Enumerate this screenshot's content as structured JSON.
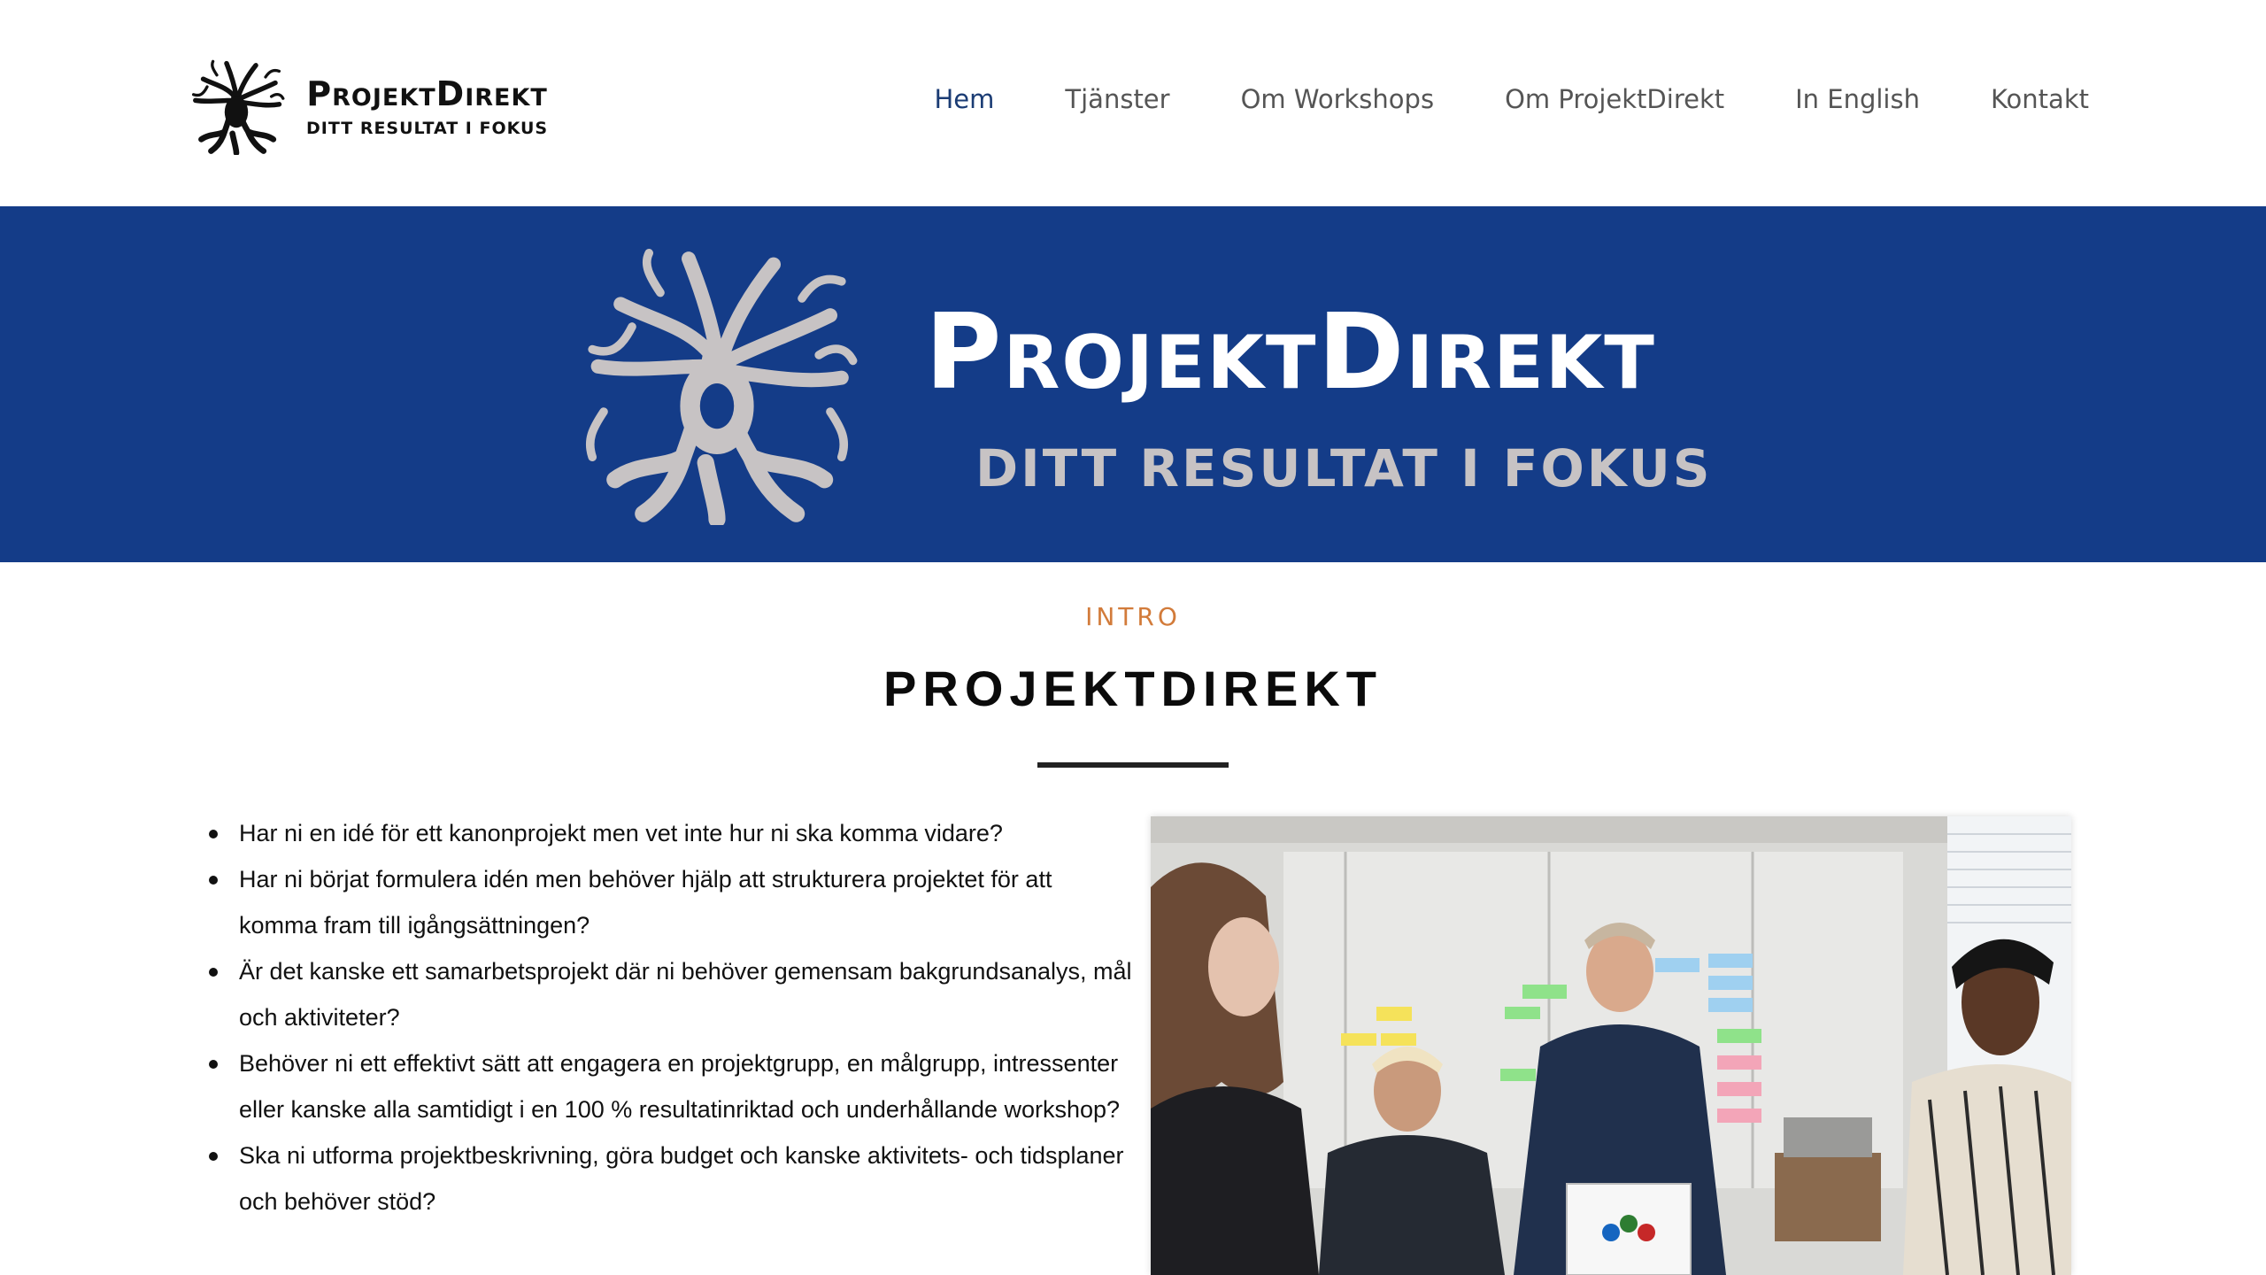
{
  "header": {
    "logo": {
      "brand_name": "ProjektDirekt",
      "tagline": "DITT RESULTAT I FOKUS"
    },
    "nav": [
      {
        "label": "Hem",
        "active": true
      },
      {
        "label": "Tjänster",
        "active": false
      },
      {
        "label": "Om Workshops",
        "active": false
      },
      {
        "label": "Om ProjektDirekt",
        "active": false
      },
      {
        "label": "In English",
        "active": false
      },
      {
        "label": "Kontakt",
        "active": false
      }
    ]
  },
  "banner": {
    "brand_name": "ProjektDirekt",
    "tagline": "DITT RESULTAT I FOKUS"
  },
  "intro": {
    "label": "INTRO",
    "title": "PROJEKTDIREKT",
    "bullets": [
      "Har ni en idé för ett kanonprojekt men vet inte hur ni ska komma vidare?",
      "Har ni börjat formulera idén men behöver hjälp att strukturera projektet för att komma fram till igångsättningen?",
      "Är det kanske ett samarbetsprojekt där ni behöver gemensam bakgrundsanalys, mål och aktiviteter?",
      "Behöver ni ett effektivt sätt att engagera en projektgrupp, en målgrupp, intressenter eller kanske alla samtidigt i en 100 % resultatinriktad och underhållande workshop?",
      "Ska ni utforma projektbeskrivning, göra budget och kanske aktivitets- och tidsplaner och behöver stöd?"
    ]
  },
  "colors": {
    "banner_bg": "#143c88",
    "nav_active": "#1b3c74",
    "intro_label": "#d27b3a",
    "tagline_grey": "#c7c3c4"
  },
  "icons": {
    "logo": "tree-of-life-icon",
    "banner_logo": "tree-of-life-icon"
  }
}
